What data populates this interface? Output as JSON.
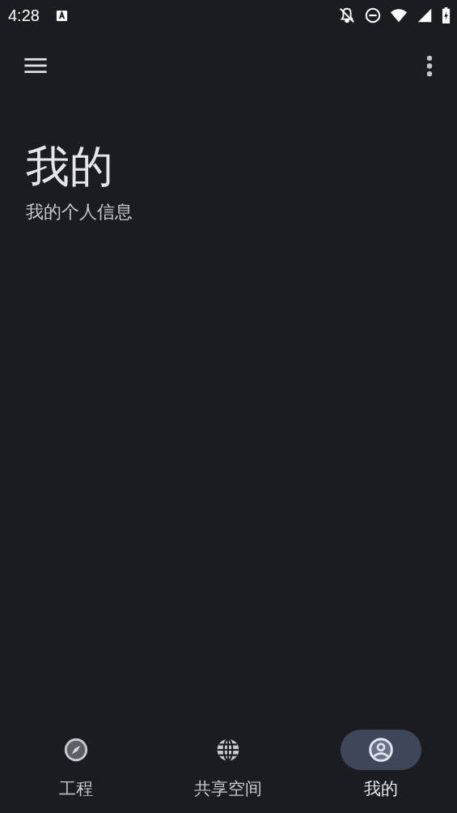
{
  "status_bar": {
    "time": "4:28"
  },
  "header": {
    "title": "我的",
    "subtitle": "我的个人信息"
  },
  "bottom_nav": [
    {
      "label": "工程",
      "kind": "compass",
      "selected": false
    },
    {
      "label": "共享空间",
      "kind": "globe",
      "selected": false
    },
    {
      "label": "我的",
      "kind": "person",
      "selected": true
    }
  ]
}
